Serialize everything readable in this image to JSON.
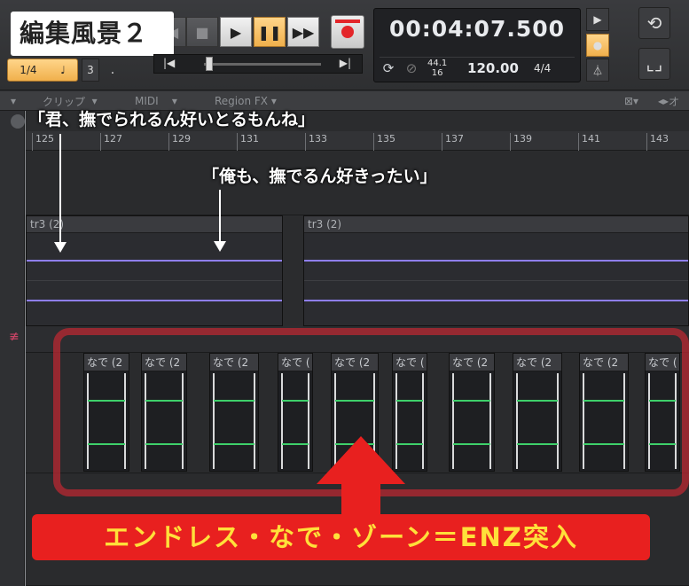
{
  "title_overlay": "編集風景２",
  "transport": {
    "play_icon": "play-icon",
    "pause_icon": "pause-icon",
    "ffwd_icon": "fast-forward-icon",
    "stop_icon": "stop-icon",
    "snap_value": "1/4",
    "snap_note_icon": "quarter-note-icon",
    "snap_count": "3",
    "snap_dot": ".",
    "timecode": "00:04:07.500",
    "sample_rate_top": "44.1",
    "sample_rate_bottom": "16",
    "tempo": "120.00",
    "meter": "4/4"
  },
  "tabs": {
    "clip": "クリップ",
    "midi": "MIDI",
    "region_fx": "Region FX",
    "right": "オ"
  },
  "ruler": {
    "labels": [
      "125",
      "127",
      "129",
      "131",
      "133",
      "135",
      "137",
      "139",
      "141",
      "143"
    ]
  },
  "clips": {
    "left_name": "tr3 (2)",
    "right_name": "tr3 (2)"
  },
  "nade_clips": [
    "なで (2",
    "なで (2",
    "なで (2",
    "なで (",
    "なで (2",
    "なで (",
    "なで (2",
    "なで (2",
    "なで (2",
    "なで ("
  ],
  "annotations": {
    "caption1": "「君、撫でられるん好いとるもんね」",
    "caption2": "「俺も、撫でるん好きったい」",
    "banner": "エンドレス・なで・ゾーン＝ENZ突入"
  },
  "colors": {
    "waveform": "#8f7ff0",
    "envelope": "#3ed06a",
    "banner_bg": "#e8201f",
    "banner_text": "#ffe03a",
    "highlight_frame": "#ba2832",
    "active_button": "#f0b04c"
  }
}
